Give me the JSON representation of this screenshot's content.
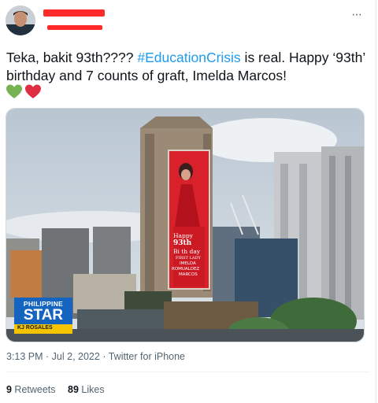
{
  "tweet": {
    "text_before": "Teka, bakit 93th???? ",
    "hashtag": "#EducationCrisis",
    "text_after": " is real. Happy ‘93th’ birthday and 7 counts of graft, Imelda Marcos!",
    "emojis": [
      "green-heart",
      "red-heart"
    ],
    "more_icon": "···"
  },
  "photo": {
    "billboard_line1": "Happy",
    "billboard_line2": "93th",
    "billboard_line3": "Bi th day",
    "billboard_line4": "FIRST LADY",
    "billboard_line5": "IMELDA",
    "billboard_line6": "ROMUALDEZ",
    "billboard_line7": "MARCOS",
    "logo_line1": "PHILIPPINE",
    "logo_line2": "STAR",
    "logo_line3": "KJ ROSALES"
  },
  "meta": {
    "time": "3:13 PM",
    "sep1": " · ",
    "date": "Jul 2, 2022",
    "sep2": " · ",
    "source": "Twitter for iPhone"
  },
  "stats": {
    "retweets_count": "9",
    "retweets_label": " Retweets",
    "likes_count": "89",
    "likes_label": " Likes"
  }
}
